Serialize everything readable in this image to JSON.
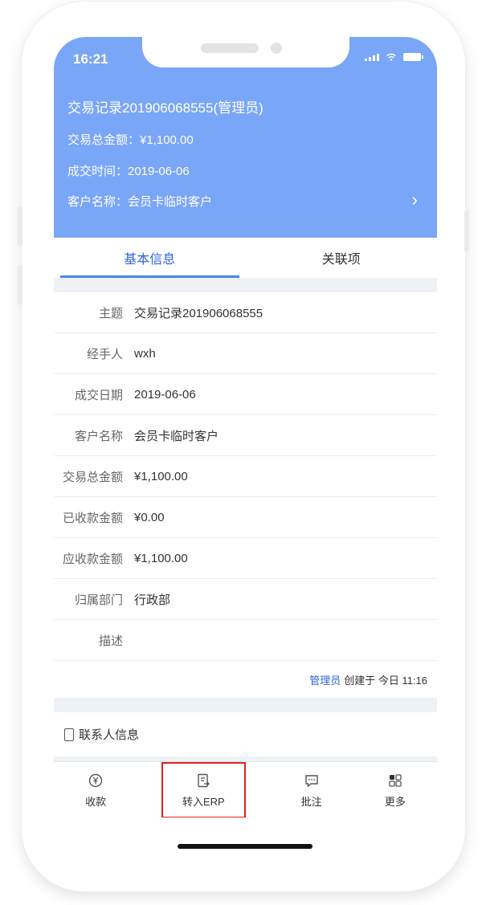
{
  "status": {
    "time": "16:21"
  },
  "header": {
    "title": "交易记录201906068555(管理员)",
    "amount": "交易总金额：¥1,100.00",
    "time": "成交时间：2019-06-06",
    "customer": "客户名称：会员卡临时客户"
  },
  "tabs": [
    {
      "label": "基本信息"
    },
    {
      "label": "关联项"
    }
  ],
  "fields": [
    {
      "label": "主题",
      "value": "交易记录201906068555"
    },
    {
      "label": "经手人",
      "value": "wxh"
    },
    {
      "label": "成交日期",
      "value": "2019-06-06"
    },
    {
      "label": "客户名称",
      "value": "会员卡临时客户"
    },
    {
      "label": "交易总金额",
      "value": "¥1,100.00"
    },
    {
      "label": "已收款金额",
      "value": "¥0.00"
    },
    {
      "label": "应收款金额",
      "value": "¥1,100.00"
    },
    {
      "label": "归属部门",
      "value": "行政部"
    },
    {
      "label": "描述",
      "value": ""
    }
  ],
  "footer": {
    "author": "管理员",
    "created": "创建于 今日 11:16"
  },
  "contact": {
    "label": "联系人信息"
  },
  "toolbar": [
    {
      "label": "收款",
      "icon": "payment-icon"
    },
    {
      "label": "转入ERP",
      "icon": "document-transfer-icon"
    },
    {
      "label": "批注",
      "icon": "comment-icon"
    },
    {
      "label": "更多",
      "icon": "grid-more-icon"
    }
  ],
  "colors": {
    "header": "#7aa6f7",
    "accent": "#2f65d9",
    "highlight": "#e02020"
  }
}
